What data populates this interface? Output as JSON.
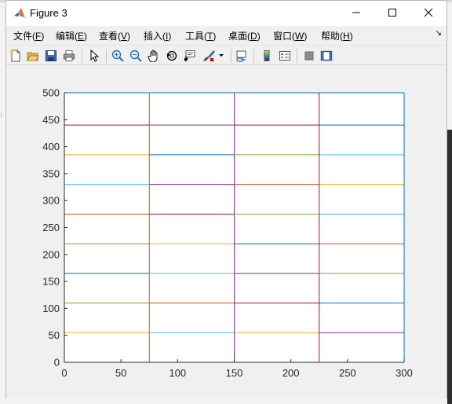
{
  "window": {
    "title": "Figure 3",
    "controls": {
      "minimize": "minimize",
      "maximize": "maximize",
      "close": "close"
    }
  },
  "menu": [
    {
      "label": "文件",
      "key": "(F)",
      "underline": "F"
    },
    {
      "label": "编辑",
      "key": "(E)",
      "underline": "E"
    },
    {
      "label": "查看",
      "key": "(V)",
      "underline": "V"
    },
    {
      "label": "插入",
      "key": "(I)",
      "underline": "I"
    },
    {
      "label": "工具",
      "key": "(T)",
      "underline": "T"
    },
    {
      "label": "桌面",
      "key": "(D)",
      "underline": "D"
    },
    {
      "label": "窗口",
      "key": "(W)",
      "underline": "W"
    },
    {
      "label": "帮助",
      "key": "(H)",
      "underline": "H"
    }
  ],
  "toolbar": [
    {
      "name": "new-figure-icon"
    },
    {
      "name": "open-file-icon"
    },
    {
      "name": "save-icon"
    },
    {
      "name": "print-icon"
    },
    {
      "name": "select-arrow-icon"
    },
    {
      "name": "zoom-in-icon"
    },
    {
      "name": "zoom-out-icon"
    },
    {
      "name": "pan-hand-icon"
    },
    {
      "name": "rotate-3d-icon"
    },
    {
      "name": "data-cursor-icon"
    },
    {
      "name": "brush-icon"
    },
    {
      "name": "link-plot-icon"
    },
    {
      "name": "insert-colorbar-icon"
    },
    {
      "name": "insert-legend-icon"
    },
    {
      "name": "hide-plot-tools-icon"
    },
    {
      "name": "show-plot-tools-icon"
    }
  ],
  "chart_data": {
    "type": "line",
    "title": "",
    "xlabel": "",
    "ylabel": "",
    "xlim": [
      0,
      300
    ],
    "ylim": [
      0,
      500
    ],
    "xticks": [
      0,
      50,
      100,
      150,
      200,
      250,
      300
    ],
    "yticks": [
      0,
      50,
      100,
      150,
      200,
      250,
      300,
      350,
      400,
      450,
      500
    ],
    "grid": false,
    "color_order": [
      "#0072bd",
      "#d95319",
      "#edb120",
      "#7e2f8e",
      "#77ac30",
      "#4dbeee",
      "#a2142f"
    ],
    "vertical_lines": [
      {
        "x": 0,
        "color": "#0072bd"
      },
      {
        "x": 75,
        "color": "#d95319"
      },
      {
        "x": 150,
        "color": "#7e2f8e"
      },
      {
        "x": 225,
        "color": "#a2142f"
      },
      {
        "x": 300,
        "color": "#0072bd"
      }
    ],
    "horizontal_segments": [
      {
        "x": [
          0,
          75
        ],
        "y": 55,
        "color": "#edb120"
      },
      {
        "x": [
          75,
          150
        ],
        "y": 55,
        "color": "#4dbeee"
      },
      {
        "x": [
          150,
          225
        ],
        "y": 55,
        "color": "#edb120"
      },
      {
        "x": [
          225,
          300
        ],
        "y": 55,
        "color": "#7e2f8e"
      },
      {
        "x": [
          0,
          75
        ],
        "y": 110,
        "color": "#77ac30"
      },
      {
        "x": [
          75,
          150
        ],
        "y": 110,
        "color": "#d95319"
      },
      {
        "x": [
          150,
          225
        ],
        "y": 110,
        "color": "#a2142f"
      },
      {
        "x": [
          225,
          300
        ],
        "y": 110,
        "color": "#0072bd"
      },
      {
        "x": [
          0,
          75
        ],
        "y": 165,
        "color": "#0072bd"
      },
      {
        "x": [
          75,
          150
        ],
        "y": 165,
        "color": "#4dbeee"
      },
      {
        "x": [
          150,
          225
        ],
        "y": 165,
        "color": "#7e2f8e"
      },
      {
        "x": [
          225,
          300
        ],
        "y": 165,
        "color": "#77ac30"
      },
      {
        "x": [
          0,
          75
        ],
        "y": 220,
        "color": "#77ac30"
      },
      {
        "x": [
          75,
          150
        ],
        "y": 220,
        "color": "#edb120"
      },
      {
        "x": [
          150,
          225
        ],
        "y": 220,
        "color": "#0072bd"
      },
      {
        "x": [
          225,
          300
        ],
        "y": 220,
        "color": "#d95319"
      },
      {
        "x": [
          0,
          75
        ],
        "y": 275,
        "color": "#d95319"
      },
      {
        "x": [
          75,
          150
        ],
        "y": 275,
        "color": "#a2142f"
      },
      {
        "x": [
          150,
          225
        ],
        "y": 275,
        "color": "#77ac30"
      },
      {
        "x": [
          225,
          300
        ],
        "y": 275,
        "color": "#4dbeee"
      },
      {
        "x": [
          0,
          75
        ],
        "y": 330,
        "color": "#4dbeee"
      },
      {
        "x": [
          75,
          150
        ],
        "y": 330,
        "color": "#7e2f8e"
      },
      {
        "x": [
          150,
          225
        ],
        "y": 330,
        "color": "#d95319"
      },
      {
        "x": [
          225,
          300
        ],
        "y": 330,
        "color": "#edb120"
      },
      {
        "x": [
          0,
          75
        ],
        "y": 385,
        "color": "#edb120"
      },
      {
        "x": [
          75,
          150
        ],
        "y": 385,
        "color": "#0072bd"
      },
      {
        "x": [
          150,
          225
        ],
        "y": 385,
        "color": "#77ac30"
      },
      {
        "x": [
          225,
          300
        ],
        "y": 385,
        "color": "#4dbeee"
      },
      {
        "x": [
          0,
          75
        ],
        "y": 440,
        "color": "#a2142f"
      },
      {
        "x": [
          75,
          150
        ],
        "y": 440,
        "color": "#7e2f8e"
      },
      {
        "x": [
          150,
          225
        ],
        "y": 440,
        "color": "#a2142f"
      },
      {
        "x": [
          225,
          300
        ],
        "y": 440,
        "color": "#0072bd"
      },
      {
        "x": [
          0,
          300
        ],
        "y": 500,
        "color": "#0072bd"
      }
    ]
  }
}
